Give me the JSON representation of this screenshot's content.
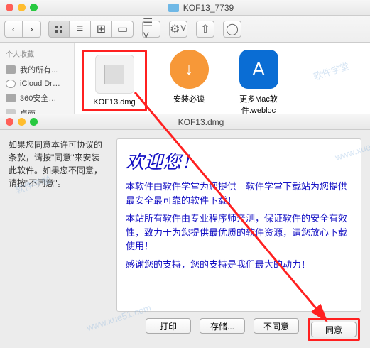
{
  "window": {
    "title": "KOF13_7739"
  },
  "sidebar": {
    "header": "个人收藏",
    "items": [
      {
        "label": "我的所有..."
      },
      {
        "label": "iCloud Dr…"
      },
      {
        "label": "360安全…"
      },
      {
        "label": "桌面"
      }
    ]
  },
  "files": [
    {
      "label": "KOF13.dmg"
    },
    {
      "label": "安装必读"
    },
    {
      "label": "更多Mac软件.webloc"
    }
  ],
  "dialog": {
    "title": "KOF13.dmg",
    "side_text": "如果您同意本许可协议的条款，请按\"同意\"来安装此软件。如果您不同意，请按\"不同意\"。",
    "welcome_title": "欢迎您！",
    "welcome_p1": "本软件由软件学堂为您提供—软件学堂下载站为您提供最安全最可靠的软件下载！",
    "welcome_p2": "本站所有软件由专业程序师亲测，保证软件的安全有效性，致力于为您提供最优质的软件资源，请您放心下载使用！",
    "welcome_p3": "感谢您的支持，您的支持是我们最大的动力！",
    "buttons": {
      "print": "打印",
      "save": "存储...",
      "disagree": "不同意",
      "agree": "同意"
    }
  },
  "watermark": "软件学堂 www.xue51.com"
}
